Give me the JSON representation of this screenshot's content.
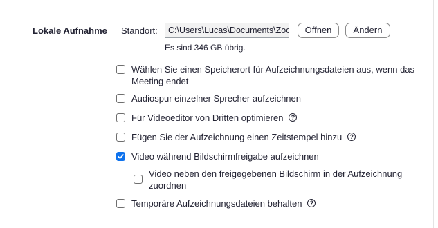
{
  "section": {
    "title": "Lokale Aufnahme"
  },
  "location": {
    "label": "Standort:",
    "path_value": "C:\\Users\\Lucas\\Documents\\Zoom",
    "open_button": "Öffnen",
    "change_button": "Ändern",
    "free_space": "Es sind 346 GB übrig."
  },
  "options": [
    {
      "label": "Wählen Sie einen Speicherort für Aufzeichnungsdateien aus, wenn das Meeting endet",
      "checked": false
    },
    {
      "label": "Audiospur einzelner Sprecher aufzeichnen",
      "checked": false
    },
    {
      "label": "Für Videoeditor von Dritten optimieren",
      "checked": false,
      "help_icon": "?"
    },
    {
      "label": "Fügen Sie der Aufzeichnung einen Zeitstempel hinzu",
      "checked": false,
      "help_icon": "?"
    },
    {
      "label": "Video während Bildschirmfreigabe aufzeichnen",
      "checked": true
    },
    {
      "label": "Video neben den freigegebenen Bildschirm in der Aufzeichnung zuordnen",
      "checked": false
    },
    {
      "label": "Temporäre Aufzeichnungsdateien behalten",
      "checked": false,
      "help_icon": "?"
    }
  ],
  "colors": {
    "accent": "#0e72ed",
    "text": "#232333"
  }
}
